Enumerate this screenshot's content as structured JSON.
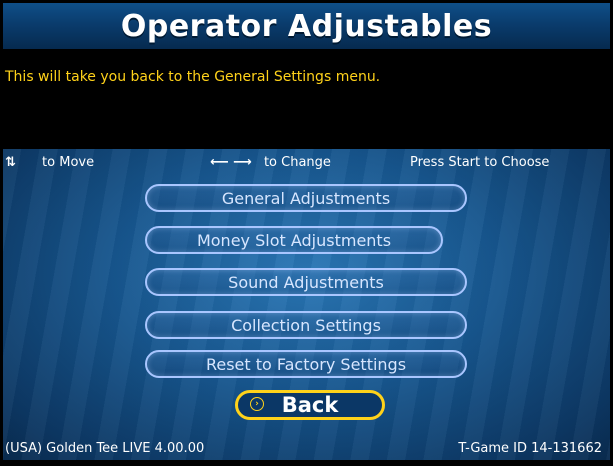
{
  "header": {
    "title": "Operator Adjustables"
  },
  "message": {
    "text": "This will take you back to the General Settings menu."
  },
  "hints": {
    "move_arrows": "⇅",
    "move_label": "to Move",
    "change_arrows": "⟵ ⟶",
    "change_label": "to Change",
    "choose_label": "Press Start to Choose"
  },
  "menu": {
    "items": [
      {
        "label": "General Adjustments"
      },
      {
        "label": "Money Slot Adjustments"
      },
      {
        "label": "Sound Adjustments"
      },
      {
        "label": "Collection Settings"
      },
      {
        "label": "Reset to Factory Settings"
      }
    ],
    "back": {
      "label": "Back",
      "selected": true
    }
  },
  "footer": {
    "version": "(USA) Golden Tee LIVE 4.00.00",
    "game_id": "T-Game ID 14-131662"
  },
  "colors": {
    "title_bar": "#0a3c6d",
    "message_text": "#ffd21a",
    "button_border": "#a9c6ff",
    "selected_border": "#ffd21a"
  }
}
